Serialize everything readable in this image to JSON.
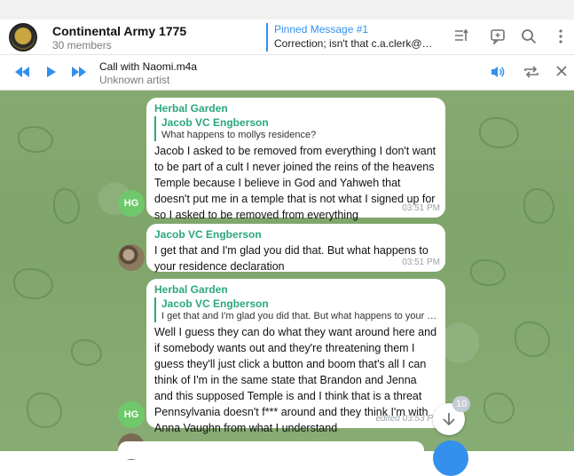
{
  "chat": {
    "title": "Continental Army 1775",
    "members": "30 members"
  },
  "pinned": {
    "title": "Pinned Message #1",
    "text": "Correction; isn't that c.a.clerk@conti..."
  },
  "player": {
    "track_title": "Call with Naomi.m4a",
    "artist": "Unknown artist"
  },
  "messages": [
    {
      "sender": "Herbal Garden",
      "reply_name": "Jacob VC Engberson",
      "reply_text": "What happens to mollys residence?",
      "text": "Jacob I asked to be removed from everything I don't want to be part of a cult I never joined the reins of the heavens Temple because I believe in God and Yahweh that doesn't put me in a temple that is not what I signed up for so I asked to be removed from everything",
      "time": "03:51 PM",
      "avatar": "HG"
    },
    {
      "sender": "Jacob VC Engberson",
      "text": "I get that and I'm glad you did that. But what happens to your residence declaration",
      "time": "03:51 PM"
    },
    {
      "sender": "Herbal Garden",
      "reply_name": "Jacob VC Engberson",
      "reply_text": "I get that and I'm glad you did that. But what happens to your re...",
      "text": "Well I guess they can do what they want around here and if somebody wants out and they're threatening them I guess they'll just click a button and boom that's all I can think of I'm in the same state that Brandon and Jenna and this supposed Temple is and I think that is a threat Pennsylvania doesn't f*** around and they think I'm with Anna Vaughn from what I understand",
      "time": "edited 03:53 P",
      "avatar": "HG"
    }
  ],
  "scroll": {
    "unread": "10"
  },
  "icons": [
    "chat-avatar",
    "pinned-list-icon",
    "comments-icon",
    "search-icon",
    "more-icon",
    "rewind-icon",
    "play-icon",
    "fast-forward-icon",
    "volume-icon",
    "repeat-icon",
    "close-icon",
    "arrow-down-icon"
  ],
  "colors": {
    "accent": "#3390ec",
    "sender_green": "#2aa87a",
    "chat_bg": "#86a970"
  }
}
